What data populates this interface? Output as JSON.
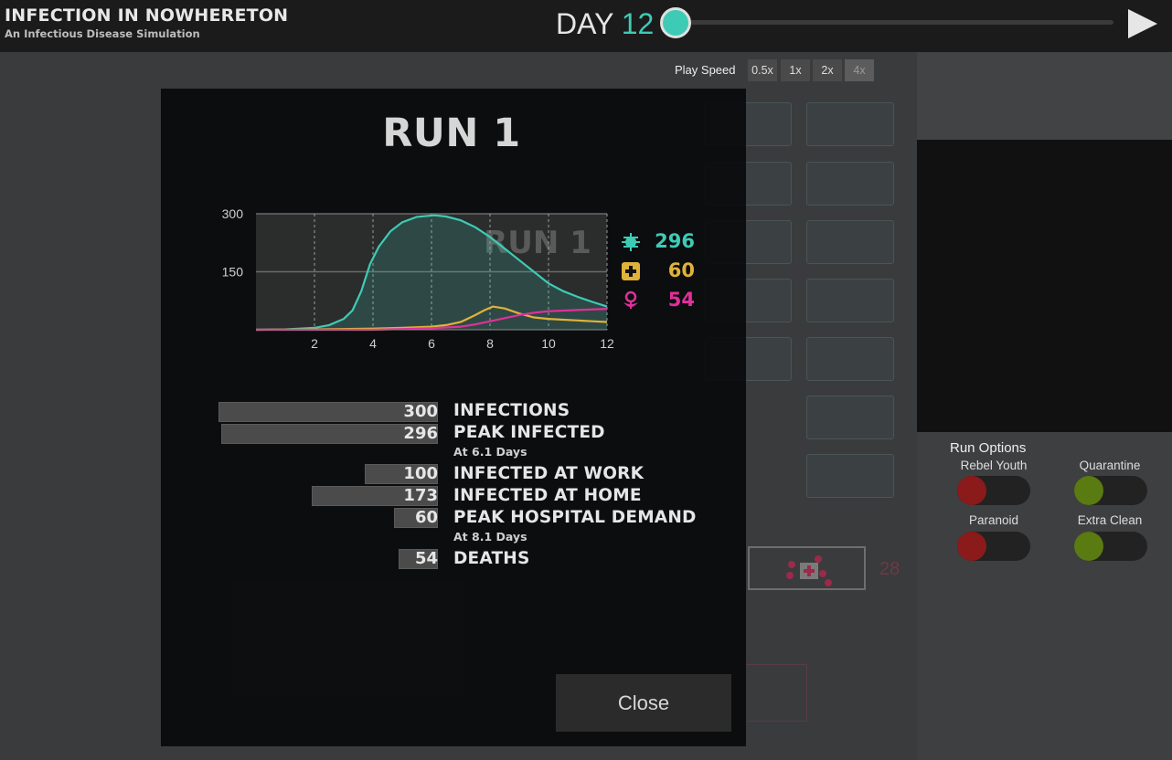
{
  "header": {
    "title": "INFECTION IN NOWHERETON",
    "subtitle": "An Infectious Disease Simulation",
    "day_label": "DAY",
    "day_value": "12",
    "slider_progress": 0.0
  },
  "play_speed": {
    "label": "Play Speed",
    "options": [
      "0.5x",
      "1x",
      "2x",
      "4x"
    ],
    "selected": "4x"
  },
  "run_options": {
    "title": "Run Options",
    "options": [
      {
        "label": "Rebel Youth",
        "state": "off",
        "color": "#8b1a1a"
      },
      {
        "label": "Quarantine",
        "state": "on",
        "color": "#5a7a12"
      },
      {
        "label": "Paranoid",
        "state": "off",
        "color": "#8b1a1a"
      },
      {
        "label": "Extra Clean",
        "state": "on",
        "color": "#5a7a12"
      }
    ]
  },
  "background": {
    "hospital_count": "28"
  },
  "modal": {
    "title": "RUN 1",
    "close_label": "Close",
    "legend": [
      {
        "icon": "virus-icon",
        "value": "296",
        "color": "#3ecbb5"
      },
      {
        "icon": "hospital-cross-icon",
        "value": "60",
        "color": "#e0b23a"
      },
      {
        "icon": "death-flower-icon",
        "value": "54",
        "color": "#e0309a"
      }
    ],
    "stats": [
      {
        "value": "300",
        "label": "INFECTIONS",
        "sub": "",
        "fraction": 1.0
      },
      {
        "value": "296",
        "label": "PEAK INFECTED",
        "sub": "At 6.1  Days",
        "fraction": 0.987
      },
      {
        "value": "100",
        "label": "INFECTED AT WORK",
        "sub": "",
        "fraction": 0.333
      },
      {
        "value": "173",
        "label": "INFECTED AT HOME",
        "sub": "",
        "fraction": 0.577
      },
      {
        "value": "60",
        "label": "PEAK HOSPITAL DEMAND",
        "sub": "At 8.1  Days",
        "fraction": 0.2
      },
      {
        "value": "54",
        "label": "DEATHS",
        "sub": "",
        "fraction": 0.18
      }
    ]
  },
  "chart_data": {
    "type": "line",
    "watermark": "RUN 1",
    "xlim": [
      0,
      12
    ],
    "ylim": [
      0,
      300
    ],
    "x_ticks": [
      2,
      4,
      6,
      8,
      10,
      12
    ],
    "y_ticks": [
      150,
      300
    ],
    "grid": true,
    "series": [
      {
        "color": "#3ecbb5",
        "points": [
          [
            0,
            0
          ],
          [
            1,
            1
          ],
          [
            2,
            5
          ],
          [
            2.5,
            12
          ],
          [
            3,
            28
          ],
          [
            3.3,
            50
          ],
          [
            3.6,
            100
          ],
          [
            3.9,
            170
          ],
          [
            4.2,
            215
          ],
          [
            4.6,
            255
          ],
          [
            5,
            278
          ],
          [
            5.5,
            292
          ],
          [
            6.1,
            296
          ],
          [
            6.5,
            293
          ],
          [
            7,
            283
          ],
          [
            7.5,
            265
          ],
          [
            8,
            240
          ],
          [
            8.5,
            210
          ],
          [
            9,
            180
          ],
          [
            9.5,
            150
          ],
          [
            10,
            120
          ],
          [
            10.5,
            100
          ],
          [
            11,
            85
          ],
          [
            11.5,
            72
          ],
          [
            12,
            60
          ]
        ]
      },
      {
        "color": "#e0b23a",
        "points": [
          [
            0,
            0
          ],
          [
            2,
            1
          ],
          [
            4,
            3
          ],
          [
            5,
            5
          ],
          [
            6,
            8
          ],
          [
            6.5,
            12
          ],
          [
            7,
            20
          ],
          [
            7.5,
            38
          ],
          [
            7.8,
            50
          ],
          [
            8.1,
            60
          ],
          [
            8.5,
            55
          ],
          [
            9,
            42
          ],
          [
            9.5,
            32
          ],
          [
            10,
            28
          ],
          [
            10.5,
            26
          ],
          [
            11,
            24
          ],
          [
            11.5,
            22
          ],
          [
            12,
            20
          ]
        ]
      },
      {
        "color": "#e0309a",
        "points": [
          [
            0,
            0
          ],
          [
            4,
            0
          ],
          [
            5,
            2
          ],
          [
            6,
            4
          ],
          [
            7,
            8
          ],
          [
            7.5,
            14
          ],
          [
            8,
            22
          ],
          [
            8.5,
            30
          ],
          [
            9,
            38
          ],
          [
            9.5,
            44
          ],
          [
            10,
            48
          ],
          [
            11,
            51
          ],
          [
            12,
            54
          ]
        ]
      }
    ]
  }
}
